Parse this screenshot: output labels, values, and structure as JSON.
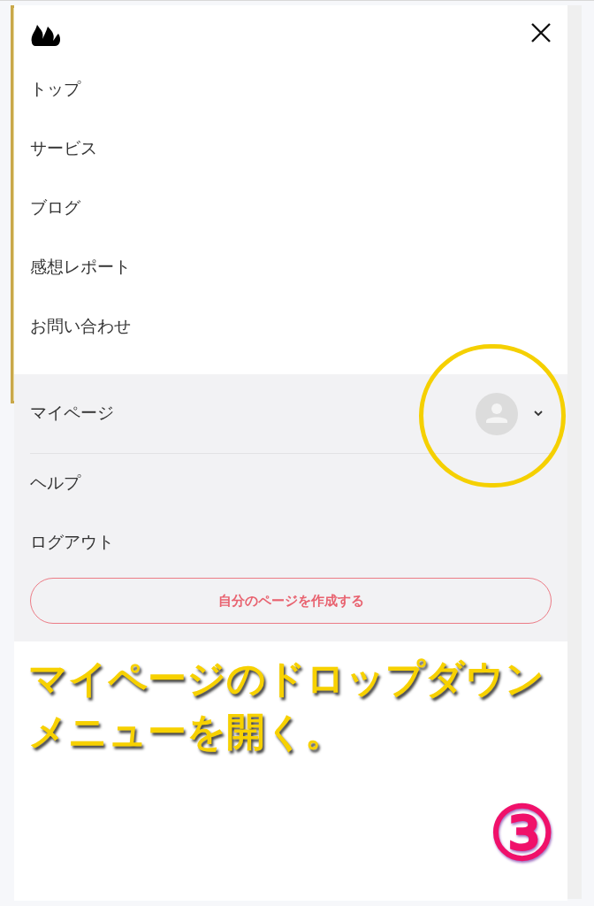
{
  "menu_items": [
    "トップ",
    "サービス",
    "ブログ",
    "感想レポート",
    "お問い合わせ"
  ],
  "account": {
    "label": "マイページ",
    "sub_items": [
      "ヘルプ",
      "ログアウト"
    ],
    "create_button": "自分のページを作成する"
  },
  "annotation": {
    "lines": [
      "マイページのドロップダウン",
      "メニューを開く。"
    ],
    "step": "③"
  }
}
